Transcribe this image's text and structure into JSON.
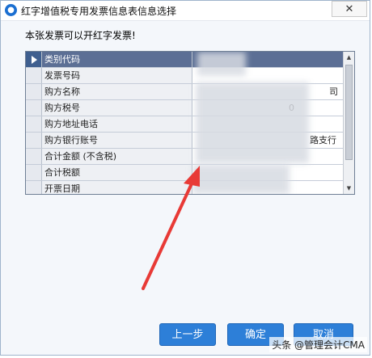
{
  "window": {
    "title": "红字增值税专用发票信息表信息选择",
    "close_label": "✕"
  },
  "prompt": "本张发票可以开红字发票!",
  "grid": {
    "rows": [
      {
        "label": "类别代码",
        "value": ""
      },
      {
        "label": "发票号码",
        "value": ""
      },
      {
        "label": "购方名称",
        "value": "司"
      },
      {
        "label": "购方税号",
        "value": "0"
      },
      {
        "label": "购方地址电话",
        "value": ""
      },
      {
        "label": "购方银行账号",
        "value": "路支行"
      },
      {
        "label": "合计金额 (不含税)",
        "value": ""
      },
      {
        "label": "合计税额",
        "value": ""
      },
      {
        "label": "开票日期",
        "value": ""
      }
    ]
  },
  "buttons": {
    "prev": "上一步",
    "ok": "确定",
    "cancel": "取消"
  },
  "watermark": "头条 @管理会计CMA",
  "colors": {
    "accent": "#2d7fd8",
    "arrow": "#e83a36"
  }
}
